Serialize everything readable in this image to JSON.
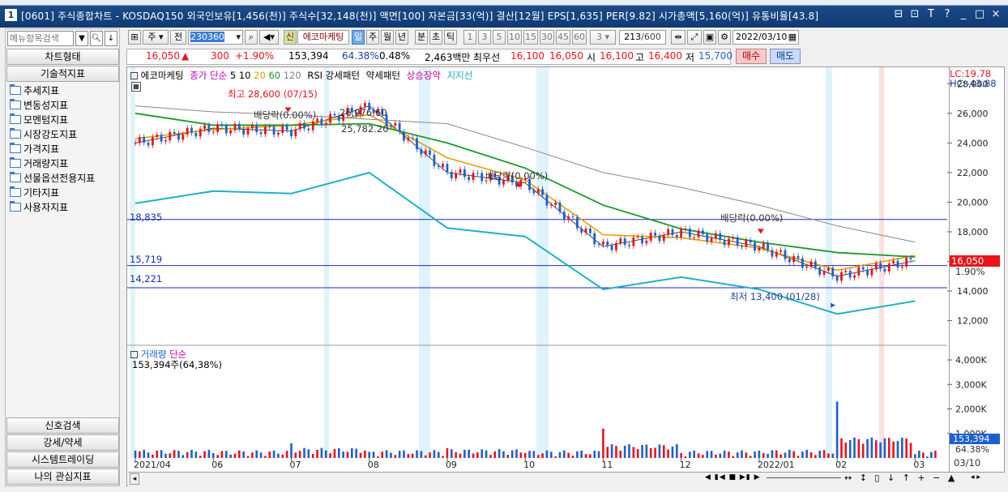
{
  "window": {
    "number": "1",
    "title": "[0601] 주식종합차트 - KOSDAQ150 외국인보유[1,456(천)] 주식수[32,148(천)] 액면[100] 자본금[33(억)] 결산[12월] EPS[1,635] PER[9.82] 시가총액[5,160(억)] 유통비율[43.8]",
    "controls": [
      "⊟",
      "⊡",
      "T",
      "?",
      "_",
      "□",
      "×"
    ]
  },
  "sidebar": {
    "search_placeholder": "메뉴항목검색",
    "chart_type_label": "차트형태",
    "tech_indicator_label": "기술적지표",
    "tree_items": [
      "추세지표",
      "변동성지표",
      "모멘텀지표",
      "시장강도지표",
      "가격지표",
      "거래량지표",
      "선물옵션전용지표",
      "기타지표",
      "사용자지표"
    ],
    "bottom_buttons": [
      "신호검색",
      "강세/약세",
      "시스템트레이딩",
      "나의 관심지표"
    ]
  },
  "toolbar": {
    "period_combo": "주",
    "prev_label": "전",
    "code": "230360",
    "sin_label": "신",
    "stock_name": "에코마케팅",
    "period_tabs": [
      "일",
      "주",
      "월",
      "년",
      "분",
      "초",
      "틱"
    ],
    "minute_options": [
      "1",
      "3",
      "5",
      "10",
      "15",
      "30",
      "45",
      "60"
    ],
    "minute_combo": "3",
    "count": "213",
    "count_total": "/600",
    "date": "2022/03/10"
  },
  "price_bar": {
    "price": "16,050",
    "change_arrow": "▲",
    "change": "300",
    "change_rate": "+1.90%",
    "volume": "153,394",
    "vol_rate": "64.38%",
    "turnover": "0.48%",
    "amount": "2,463백만",
    "best_label": "최우선",
    "best_ask": "16,100",
    "best_bid": "16,050",
    "open_label": "시",
    "open": "16,100",
    "high_label": "고",
    "high": "16,400",
    "low_label": "저",
    "low": "15,700",
    "buy_label": "매수",
    "sell_label": "매도"
  },
  "chart": {
    "legend_stock": "에코마케팅",
    "legend_ma_title": "종가 단순",
    "legend_ma": [
      {
        "label": "5",
        "color": "#000000"
      },
      {
        "label": "10",
        "color": "#000000"
      },
      {
        "label": "20",
        "color": "#e8a000"
      },
      {
        "label": "60",
        "color": "#1a9a2a"
      },
      {
        "label": "120",
        "color": "#808080"
      }
    ],
    "legend_patterns": [
      "RSI 강세패턴",
      "약세패턴"
    ],
    "legend_rise": "상승장악",
    "legend_support": "지지선",
    "annotations": {
      "high": "최고 28,600 (07/15)",
      "low": "최저 13,400 (01/28)",
      "div1": "배당락(0.00%)",
      "div2": "배당락(0.00%)",
      "div3": "배당락(0.00%)",
      "p1": "26,976.60",
      "p2": "25,782.20",
      "line1": "18,835",
      "line2": "15,719",
      "line3": "14,221",
      "lc": "LC:19.78",
      "hc": "HC:-43.88",
      "cur_price": "16,050",
      "cur_rate": "1.90%"
    },
    "volume_title": "거래량",
    "volume_title2": "단순",
    "volume_value": "153,394주(64,38%)",
    "volume_box": "153,394",
    "volume_rate": "64.38%",
    "x_labels": [
      "2021/04",
      "06",
      "07",
      "08",
      "09",
      "10",
      "11",
      "12",
      "2022/01",
      "02",
      "03"
    ],
    "x_right": "03/10",
    "colors": {
      "up": "#e8141a",
      "down": "#1d5fd0",
      "ma20": "#e8a000",
      "ma60": "#1a9a2a",
      "envelope": "#1fb0c8",
      "support": "#1b2bc0"
    }
  },
  "chart_data": [
    {
      "type": "line",
      "title": "에코마케팅",
      "y_ticks": [
        12000,
        14000,
        16000,
        18000,
        20000,
        22000,
        24000,
        26000,
        28000
      ],
      "ylim": [
        10500,
        29000
      ],
      "x": [
        "2021/04",
        "06",
        "07",
        "08",
        "09",
        "10",
        "11",
        "12",
        "2022/01",
        "02",
        "03"
      ],
      "series": [
        {
          "name": "종가",
          "values": [
            24000,
            25000,
            24800,
            26500,
            22000,
            21300,
            17000,
            18000,
            17000,
            15000,
            16050
          ]
        },
        {
          "name": "20",
          "values": [
            24300,
            24900,
            25200,
            25900,
            23000,
            21500,
            17800,
            17600,
            16900,
            15400,
            16400
          ]
        },
        {
          "name": "60",
          "values": [
            26000,
            25200,
            25200,
            25300,
            24000,
            22300,
            19800,
            18200,
            17300,
            16600,
            16300
          ]
        },
        {
          "name": "120",
          "values": [
            26500,
            26100,
            25900,
            25600,
            25300,
            23700,
            22000,
            21000,
            19800,
            18400,
            17300
          ]
        }
      ],
      "hlines": [
        18835,
        15719,
        14221
      ]
    },
    {
      "type": "bar",
      "title": "거래량",
      "y_ticks": [
        "1,000K",
        "2,000K",
        "3,000K",
        "4,000K"
      ],
      "ylim": [
        0,
        4200
      ],
      "x": [
        "2021/04",
        "06",
        "07",
        "08",
        "09",
        "10",
        "11",
        "12",
        "2022/01",
        "02",
        "03"
      ],
      "values": [
        300,
        200,
        600,
        250,
        400,
        200,
        1200,
        200,
        300,
        2300,
        153
      ]
    }
  ]
}
